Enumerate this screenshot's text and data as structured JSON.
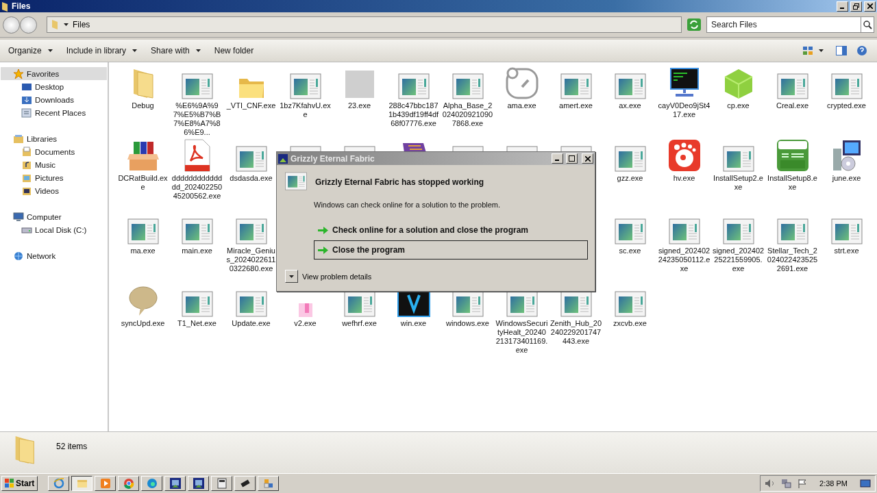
{
  "window": {
    "title": "Files"
  },
  "address": {
    "path": "Files"
  },
  "search": {
    "placeholder": "Search Files"
  },
  "toolbar": [
    {
      "label": "Organize",
      "menu": true
    },
    {
      "label": "Include in library",
      "menu": true
    },
    {
      "label": "Share with",
      "menu": true
    },
    {
      "label": "New folder",
      "menu": false
    }
  ],
  "sidebar": [
    {
      "label": "Favorites",
      "kind": "star",
      "selected": true,
      "children": [
        {
          "label": "Desktop",
          "kind": "desktop",
          "selected": false
        },
        {
          "label": "Downloads",
          "kind": "downloads",
          "selected": false
        },
        {
          "label": "Recent Places",
          "kind": "recent",
          "selected": false
        }
      ]
    },
    {
      "label": "Libraries",
      "kind": "library",
      "selected": false,
      "children": [
        {
          "label": "Documents",
          "kind": "documents",
          "selected": false
        },
        {
          "label": "Music",
          "kind": "music",
          "selected": false
        },
        {
          "label": "Pictures",
          "kind": "pictures",
          "selected": false
        },
        {
          "label": "Videos",
          "kind": "videos",
          "selected": false
        }
      ]
    },
    {
      "label": "Computer",
      "kind": "computer",
      "selected": false,
      "children": [
        {
          "label": "Local Disk (C:)",
          "kind": "disk",
          "selected": false
        }
      ]
    },
    {
      "label": "Network",
      "kind": "network",
      "selected": false
    }
  ],
  "files": [
    {
      "label": "Debug",
      "kind": "folder"
    },
    {
      "label": "%E6%9A%97%E5%B7%B7%E8%A7%86%E9...",
      "kind": "exe"
    },
    {
      "label": "_VTI_CNF.exe",
      "kind": "folder-open"
    },
    {
      "label": "1bz7KfahvU.exe",
      "kind": "exe"
    },
    {
      "label": "23.exe",
      "kind": "blurred"
    },
    {
      "label": "288c47bbc1871b439df19ff4df68f07776.exe",
      "kind": "exe"
    },
    {
      "label": "Alpha_Base_20240209210907868.exe",
      "kind": "exe"
    },
    {
      "label": "ama.exe",
      "kind": "gauge"
    },
    {
      "label": "amert.exe",
      "kind": "exe"
    },
    {
      "label": "ax.exe",
      "kind": "exe"
    },
    {
      "label": "cayV0Deo9jSt417.exe",
      "kind": "terminal"
    },
    {
      "label": "cp.exe",
      "kind": "cube"
    },
    {
      "label": "Creal.exe",
      "kind": "exe"
    },
    {
      "label": "crypted.exe",
      "kind": "exe"
    },
    {
      "label": "DCRatBuild.exe",
      "kind": "box"
    },
    {
      "label": "dddddddddddddd_20240225045200562.exe",
      "kind": "pdf"
    },
    {
      "label": "dsdasda.exe",
      "kind": "exe"
    },
    {
      "kind": "exe"
    },
    {
      "kind": "exe"
    },
    {
      "kind": "books"
    },
    {
      "kind": "exe"
    },
    {
      "kind": "exe"
    },
    {
      "kind": "exe"
    },
    {
      "label": "gzz.exe",
      "kind": "exe"
    },
    {
      "label": "hv.exe",
      "kind": "record"
    },
    {
      "label": "InstallSetup2.exe",
      "kind": "exe"
    },
    {
      "label": "InstallSetup8.exe",
      "kind": "mp3"
    },
    {
      "label": "june.exe",
      "kind": "installer"
    },
    {
      "label": "ma.exe",
      "kind": "exe"
    },
    {
      "label": "main.exe",
      "kind": "exe"
    },
    {
      "label": "Miracle_Genius_20240226110322680.exe",
      "kind": "exe"
    },
    {
      "kind": "covered"
    },
    {
      "kind": "covered"
    },
    {
      "kind": "covered"
    },
    {
      "kind": "covered"
    },
    {
      "kind": "covered"
    },
    {
      "kind": "covered"
    },
    {
      "label": "sc.exe",
      "kind": "exe"
    },
    {
      "label": "signed_20240224235050112.exe",
      "kind": "exe"
    },
    {
      "label": "signed_20240225221559905.exe",
      "kind": "exe"
    },
    {
      "label": "Stellar_Tech_20240224235252691.exe",
      "kind": "exe"
    },
    {
      "label": "strt.exe",
      "kind": "exe"
    },
    {
      "label": "syncUpd.exe",
      "kind": "speech"
    },
    {
      "label": "T1_Net.exe",
      "kind": "exe"
    },
    {
      "label": "Update.exe",
      "kind": "exe"
    },
    {
      "label": "v2.exe",
      "kind": "pink"
    },
    {
      "label": "wefhrf.exe",
      "kind": "exe"
    },
    {
      "label": "win.exe",
      "kind": "vee"
    },
    {
      "label": "windows.exe",
      "kind": "exe"
    },
    {
      "label": "WindowsSecurityHealt_20240213173401169.exe",
      "kind": "exe"
    },
    {
      "label": "Zenith_Hub_20240229201747443.exe",
      "kind": "exe"
    },
    {
      "label": "zxcvb.exe",
      "kind": "exe"
    }
  ],
  "details": {
    "count": "52 items"
  },
  "dialog": {
    "title": "Grizzly Eternal Fabric",
    "heading": "Grizzly Eternal Fabric has stopped working",
    "message": "Windows can check online for a solution to the problem.",
    "options": [
      {
        "label": "Check online for a solution and close the program",
        "selected": false
      },
      {
        "label": "Close the program",
        "selected": true
      }
    ],
    "details_toggle": "View problem details"
  },
  "taskbar": {
    "start": "Start",
    "apps": [
      {
        "kind": "ie",
        "selected": false
      },
      {
        "kind": "explorer",
        "selected": true
      },
      {
        "kind": "media",
        "selected": false
      },
      {
        "kind": "chrome",
        "selected": false
      },
      {
        "kind": "edge",
        "selected": false
      },
      {
        "kind": "app",
        "selected": false
      },
      {
        "kind": "app",
        "selected": false
      },
      {
        "kind": "calc",
        "selected": false
      },
      {
        "kind": "chip",
        "selected": false
      },
      {
        "kind": "tiles",
        "selected": false
      }
    ],
    "clock": "2:38 PM"
  }
}
